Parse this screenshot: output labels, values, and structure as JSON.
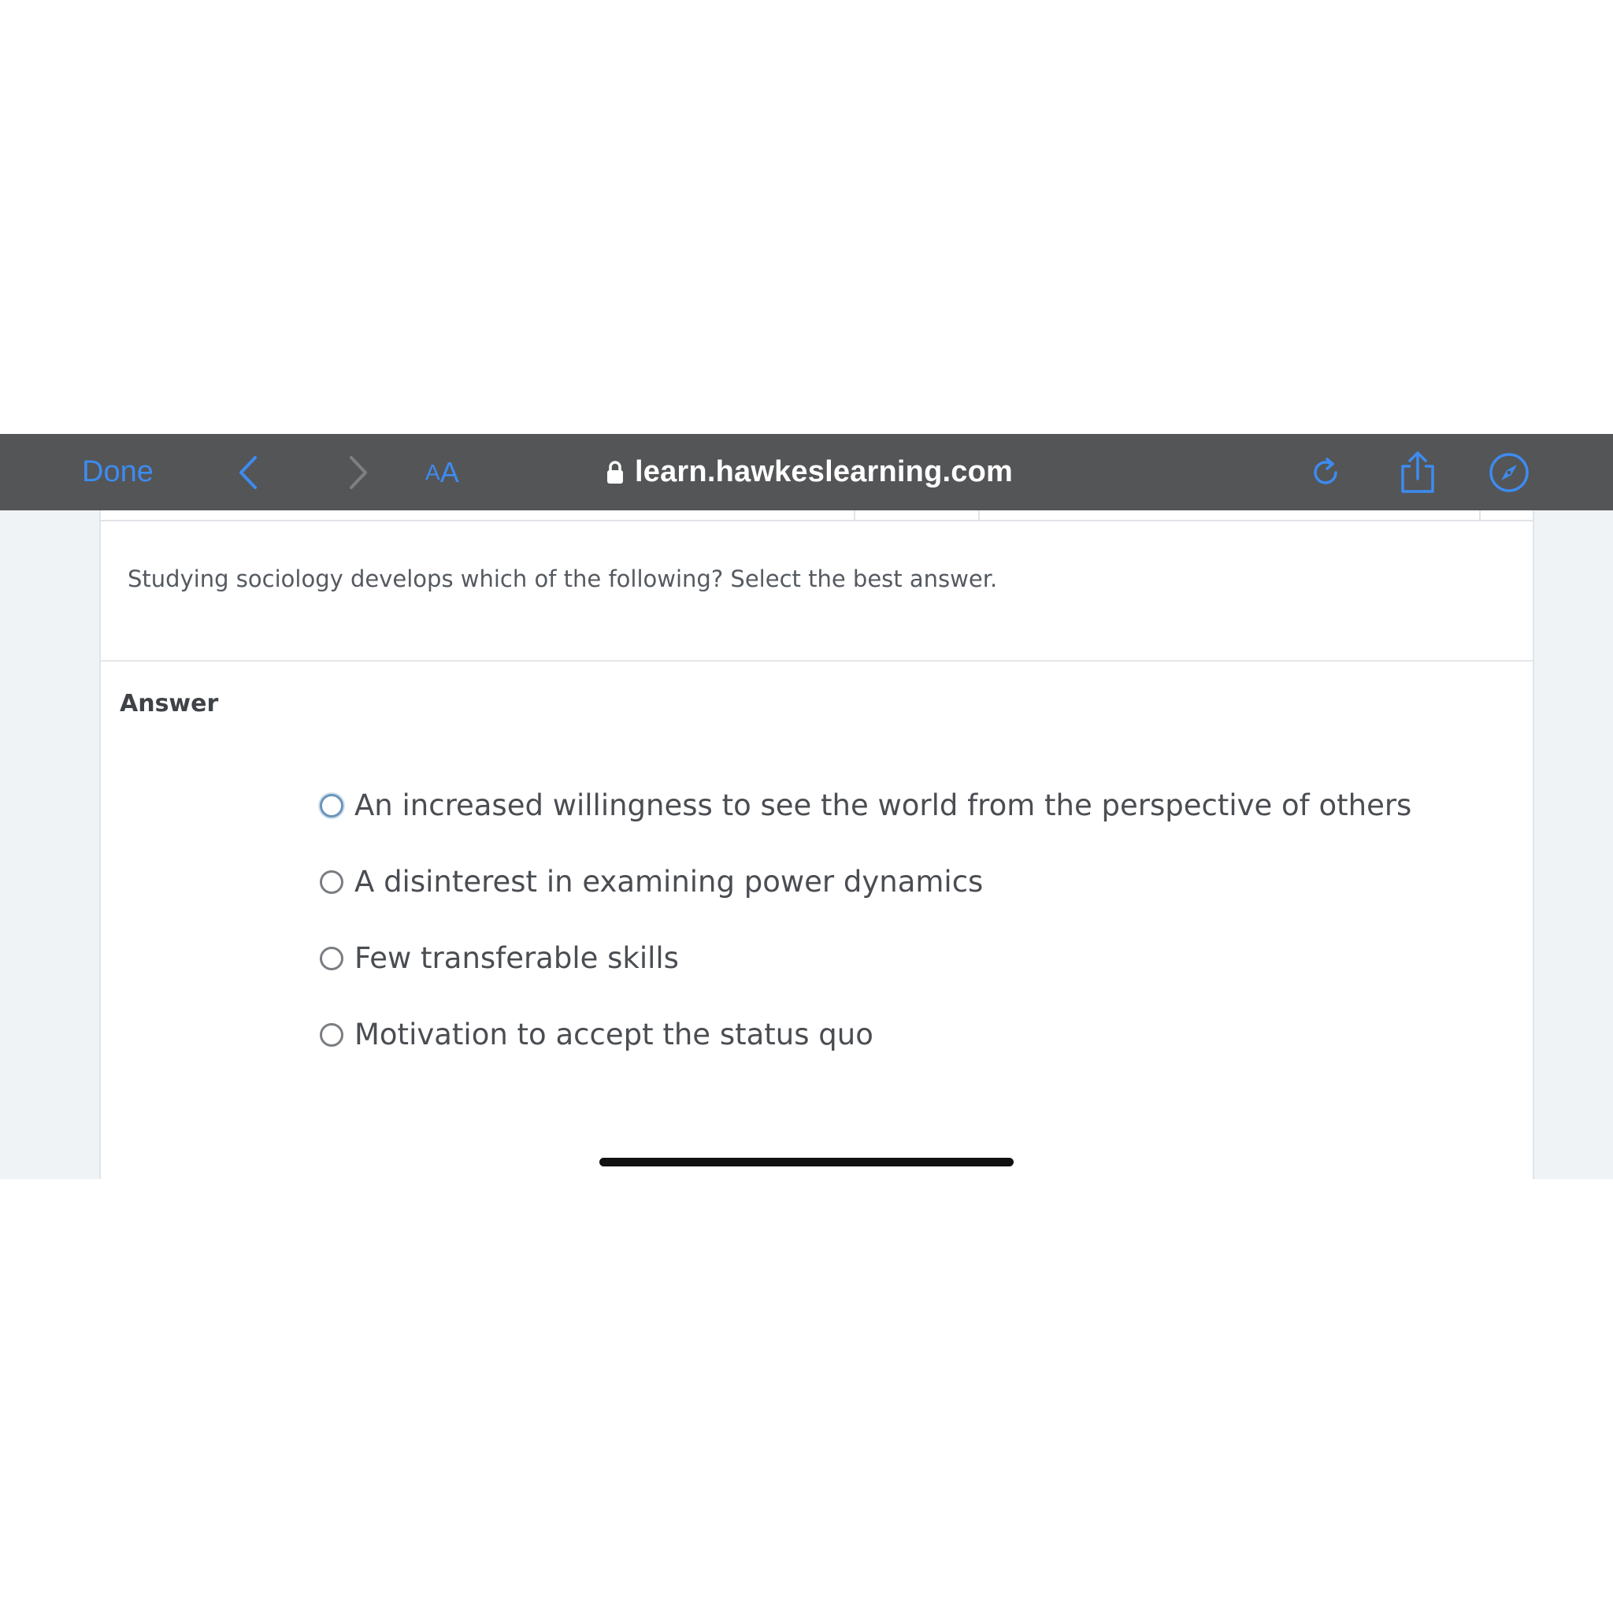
{
  "browser": {
    "done_label": "Done",
    "text_size_label_small": "A",
    "text_size_label_large": "A",
    "url": "learn.hawkeslearning.com",
    "icons": {
      "back": "chevron-left-icon",
      "forward": "chevron-right-icon",
      "lock": "lock-icon",
      "reload": "reload-icon",
      "share": "share-icon",
      "compass": "compass-icon"
    },
    "accent_color": "#3d8bf0"
  },
  "question": {
    "prompt": "Studying sociology develops which of the following? Select the best answer."
  },
  "answer": {
    "label": "Answer",
    "options": [
      {
        "text": "An increased willingness to see the world from the perspective of others",
        "selected": false
      },
      {
        "text": "A disinterest in examining power dynamics",
        "selected": false
      },
      {
        "text": "Few transferable skills",
        "selected": false
      },
      {
        "text": "Motivation to accept the status quo",
        "selected": false
      }
    ]
  }
}
